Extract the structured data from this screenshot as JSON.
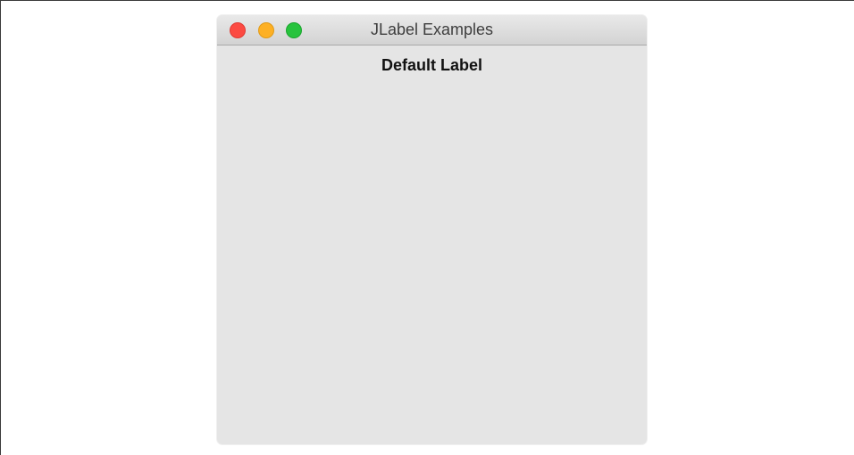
{
  "window": {
    "title": "JLabel Examples",
    "controls": {
      "close": "close-button",
      "minimize": "minimize-button",
      "zoom": "zoom-button"
    }
  },
  "content": {
    "label_text": "Default Label"
  },
  "colors": {
    "close": "#fc4a42",
    "minimize": "#fdb024",
    "zoom": "#27c33d",
    "window_bg": "#e5e5e5"
  }
}
